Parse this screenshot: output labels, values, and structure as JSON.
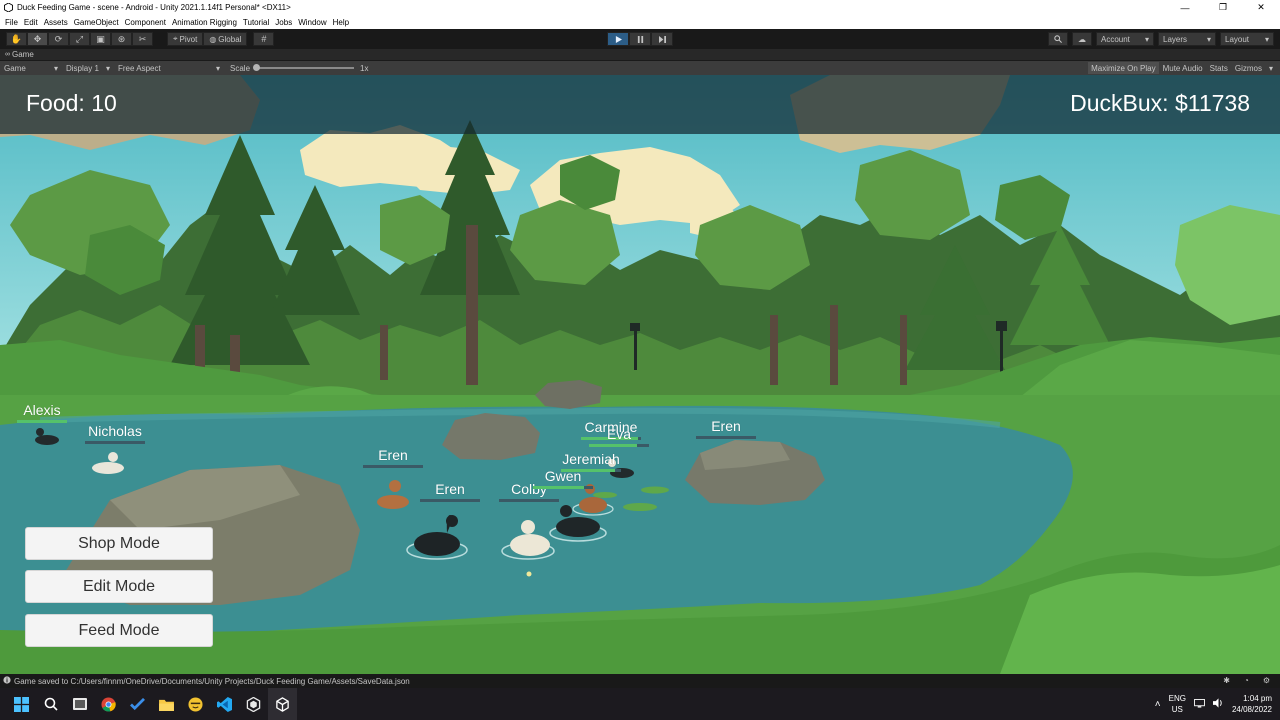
{
  "window": {
    "title": "Duck Feeding Game - scene - Android - Unity 2021.1.14f1 Personal* <DX11>",
    "controls": [
      "—",
      "❐",
      "✕"
    ]
  },
  "menu": [
    "File",
    "Edit",
    "Assets",
    "GameObject",
    "Component",
    "Animation Rigging",
    "Tutorial",
    "Jobs",
    "Window",
    "Help"
  ],
  "toolbar": {
    "pivot": "Pivot",
    "global": "Global",
    "account": "Account",
    "layers": "Layers",
    "layout": "Layout"
  },
  "tab": {
    "name": "Game"
  },
  "game_controls": {
    "view": "Game",
    "display": "Display 1",
    "aspect": "Free Aspect",
    "scale_label": "Scale",
    "scale_value": "1x",
    "maximize": "Maximize On Play",
    "mute": "Mute Audio",
    "stats": "Stats",
    "gizmos": "Gizmos"
  },
  "hud": {
    "food": "Food: 10",
    "duckbux": "DuckBux: $11738"
  },
  "modes": {
    "shop": "Shop Mode",
    "edit": "Edit Mode",
    "feed": "Feed Mode"
  },
  "ducks": [
    {
      "name": "Alexis",
      "health": 1.0
    },
    {
      "name": "Nicholas",
      "health": 0.0
    },
    {
      "name": "Eren",
      "health": 0.0
    },
    {
      "name": "Eren",
      "health": 0.0
    },
    {
      "name": "Colby",
      "health": 0.0
    },
    {
      "name": "Gwen",
      "health": 0.85
    },
    {
      "name": "Jeremiah",
      "health": 0.9
    },
    {
      "name": "Carmine",
      "health": 0.95
    },
    {
      "name": "Eva",
      "health": 0.8
    },
    {
      "name": "Eren",
      "health": 0.0
    }
  ],
  "status": {
    "message": "Game saved to C:/Users/finnm/OneDrive/Documents/Unity Projects/Duck Feeding Game/Assets/SaveData.json"
  },
  "taskbar": {
    "lang_top": "ENG",
    "lang_bottom": "US",
    "time": "1:04 pm",
    "date": "24/08/2022"
  },
  "colors": {
    "hud_text": "#ffffff",
    "health_bar": "#55c26a",
    "play_active": "#2c5d87"
  }
}
